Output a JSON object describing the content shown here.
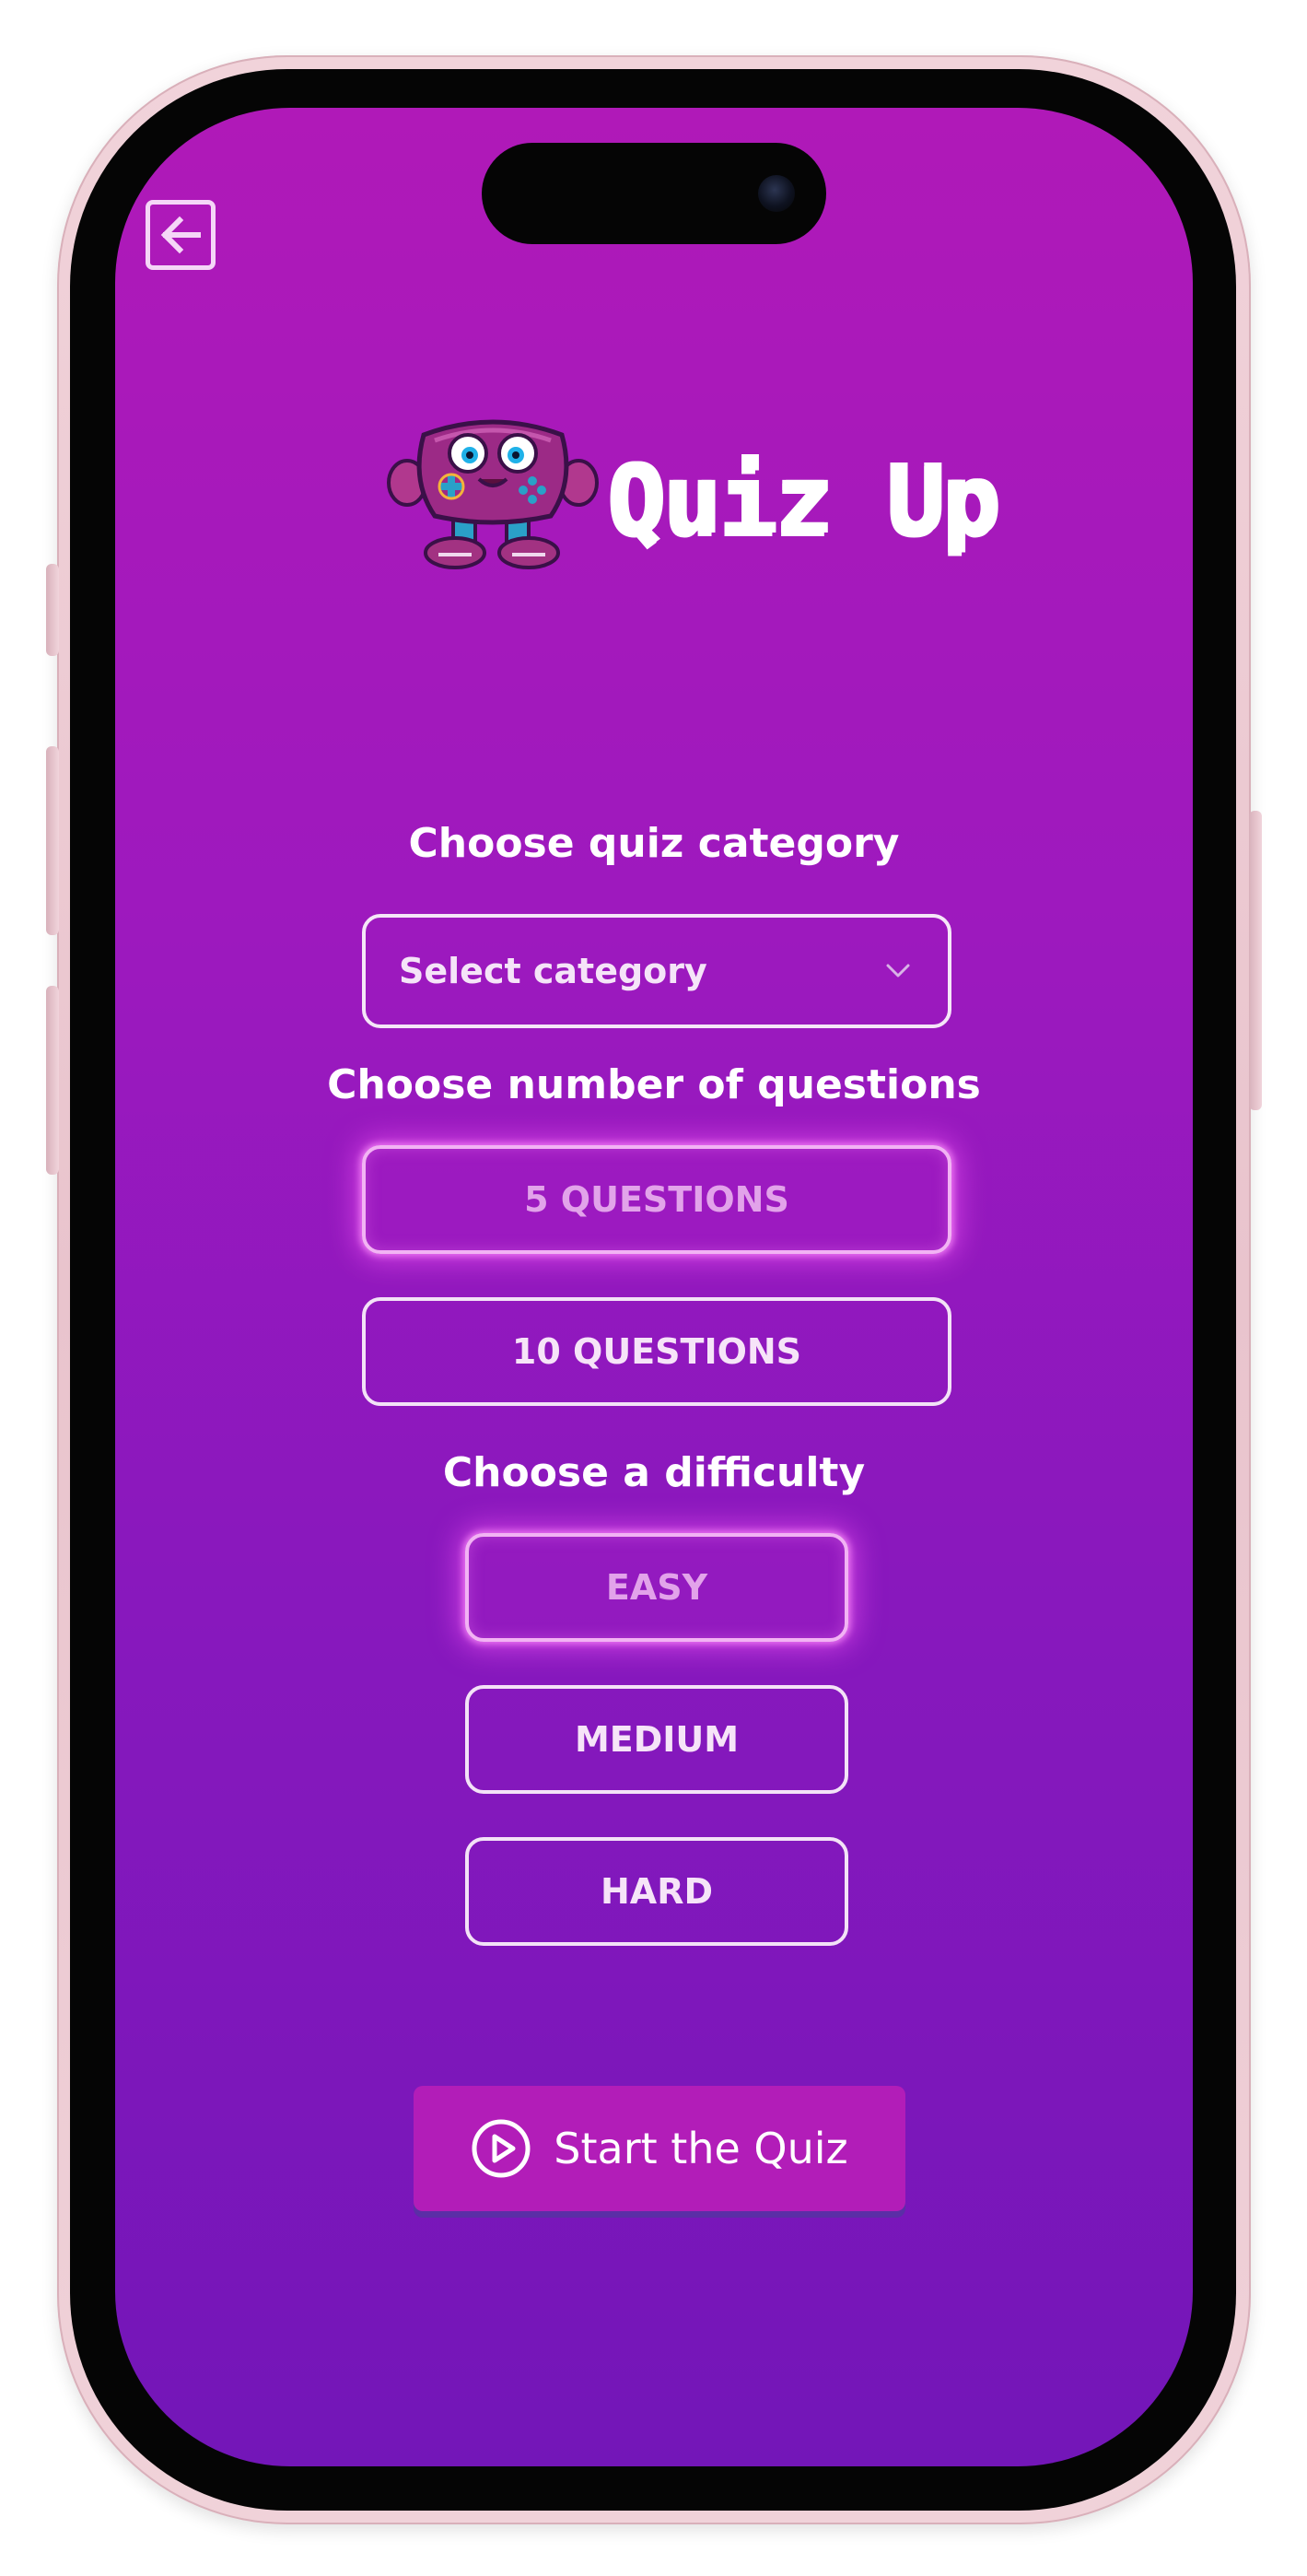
{
  "app": {
    "name": "Quiz Up"
  },
  "category": {
    "label": "Choose quiz category",
    "placeholder": "Select category"
  },
  "questions": {
    "label": "Choose number of questions",
    "options": [
      "5 QUESTIONS",
      "10 QUESTIONS"
    ],
    "selected": "5 QUESTIONS"
  },
  "difficulty": {
    "label": "Choose a difficulty",
    "options": [
      "EASY",
      "MEDIUM",
      "HARD"
    ],
    "selected": "EASY"
  },
  "start": {
    "label": "Start the Quiz"
  },
  "icons": {
    "back": "back-arrow-icon",
    "chevron": "chevron-down-icon",
    "play": "play-circle-icon"
  },
  "colors": {
    "gradient_top": "#b019b8",
    "gradient_bottom": "#7316b8",
    "start_button": "#b21db8",
    "selected_glow": "#ea50f0"
  }
}
